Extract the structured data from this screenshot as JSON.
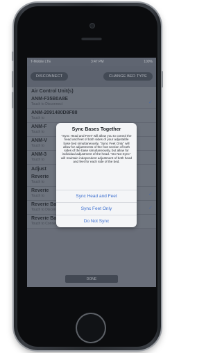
{
  "status": {
    "carrier": "T-Mobile LTE",
    "time": "3:47 PM",
    "battery": "100%"
  },
  "toolbar": {
    "disconnect_label": "DISCONNECT",
    "change_bed_label": "CHANGE BED TYPE"
  },
  "section": {
    "air_title": "Air Control Unit(s)",
    "adjust_title": "Adjust"
  },
  "air_units": [
    {
      "name": "ANM-F35B0A8E",
      "action": "Touch to Disconnect",
      "checked": true
    },
    {
      "name": "ANM-2091480D8F88",
      "action": "Touch to",
      "checked": false
    },
    {
      "name": "ANM-F",
      "action": "Touch to",
      "checked": false
    },
    {
      "name": "ANM-V",
      "action": "Touch to",
      "checked": false
    },
    {
      "name": "ANM-3",
      "action": "Touch to",
      "checked": false
    }
  ],
  "bases": [
    {
      "name": "Reverie",
      "action": "Touch to",
      "checked": false
    },
    {
      "name": "Reverie",
      "action": "Touch to",
      "checked": true
    },
    {
      "name": "Reverie Base",
      "action": "Touch to Disconnect",
      "checked": true
    },
    {
      "name": "Reverie Base",
      "action": "Touch to Connect",
      "checked": false
    }
  ],
  "done_label": "DONE",
  "modal": {
    "title": "Sync Bases Together",
    "body": "\"Sync Head and Feet\" will allow you to control the head and feet of both sides of your adjustable base bed simultaneously. \"Sync Feet Only\" will allow for adjustments of the foot section of both sides of the base simultaneously, but allow for individual adjustment of the head. \"Do Not Sync\" will maintain independent adjustment of both head and feet for each side of the bed.",
    "options": [
      "Sync Head and Feet",
      "Sync Feet Only",
      "Do Not Sync"
    ]
  },
  "colors": {
    "accent": "#3c6fd0",
    "screen_bg": "#858b96"
  }
}
